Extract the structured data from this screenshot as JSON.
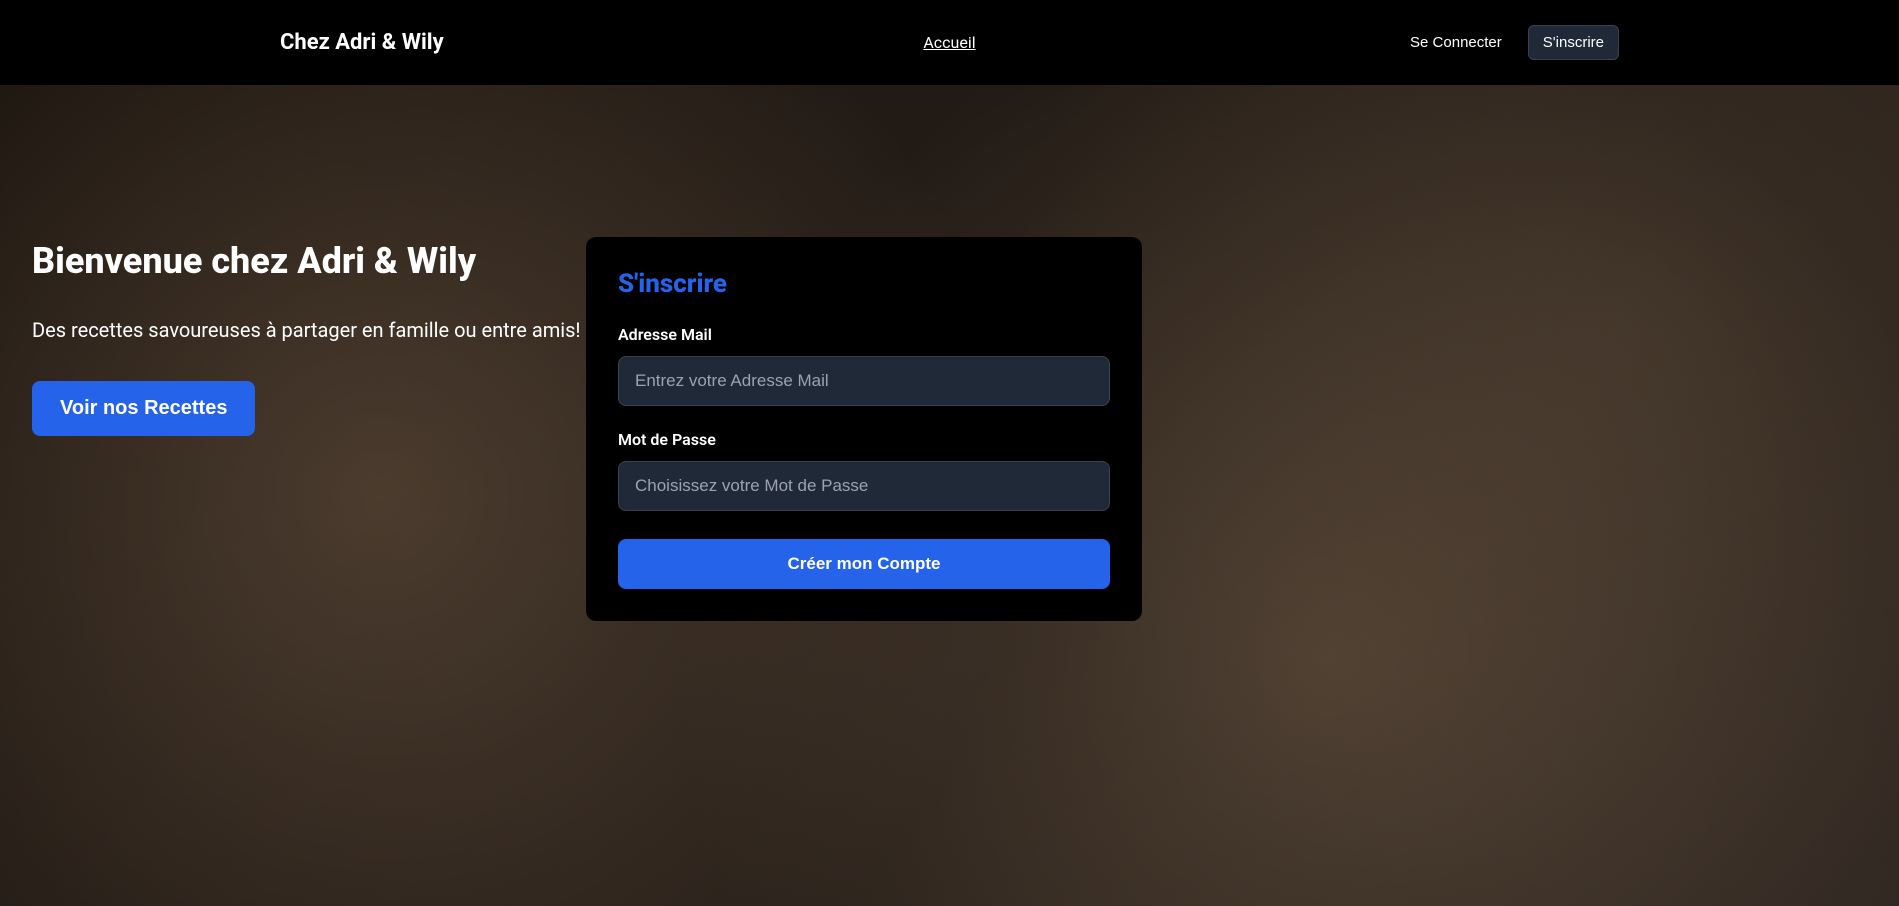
{
  "header": {
    "logo": "Chez Adri & Wily",
    "nav": {
      "home": "Accueil"
    },
    "buttons": {
      "login": "Se Connecter",
      "signup": "S'inscrire"
    }
  },
  "hero": {
    "title": "Bienvenue chez Adri & Wily",
    "subtitle": "Des recettes savoureuses à partager en famille ou entre amis!",
    "cta": "Voir nos Recettes"
  },
  "signup": {
    "title": "S'inscrire",
    "email": {
      "label": "Adresse Mail",
      "placeholder": "Entrez votre Adresse Mail"
    },
    "password": {
      "label": "Mot de Passe",
      "placeholder": "Choisissez votre Mot de Passe"
    },
    "submit": "Créer mon Compte"
  }
}
